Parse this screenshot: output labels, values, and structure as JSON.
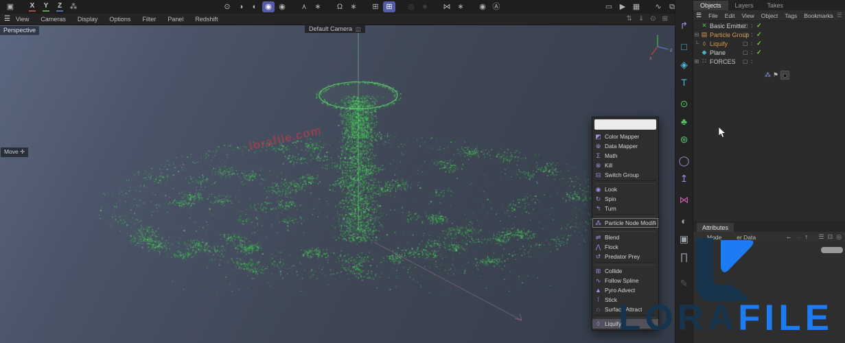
{
  "top_toolbar": {
    "icons": [
      {
        "icon": "window-tool-icon",
        "glyph": "▣",
        "cls": ""
      },
      {
        "icon": "axis-x-toggle",
        "glyph": "X",
        "cls": "gapM ax ux"
      },
      {
        "icon": "axis-y-toggle",
        "glyph": "Y",
        "cls": "ax uy"
      },
      {
        "icon": "axis-z-toggle",
        "glyph": "Z",
        "cls": "ax uz"
      },
      {
        "icon": "coordinate-system-icon",
        "glyph": "⁂",
        "cls": ""
      },
      {
        "icon": "snap-point-icon",
        "glyph": "⊙",
        "cls": "gapXL"
      },
      {
        "icon": "snap-edge-icon",
        "glyph": "◑",
        "cls": ""
      },
      {
        "icon": "snap-polygon-icon",
        "glyph": "◐",
        "cls": ""
      },
      {
        "icon": "modeling-mode-icon",
        "glyph": "◉",
        "cls": "sel"
      },
      {
        "icon": "modeling-alt-icon",
        "glyph": "◉",
        "cls": ""
      },
      {
        "icon": "character-tool-icon",
        "glyph": "⋏",
        "cls": "gapM"
      },
      {
        "icon": "gear-icon",
        "glyph": "∗",
        "cls": ""
      },
      {
        "icon": "magnet-tool-icon",
        "glyph": "Ω",
        "cls": "gapM"
      },
      {
        "icon": "gear-icon",
        "glyph": "∗",
        "cls": ""
      },
      {
        "icon": "grid-icon",
        "glyph": "⊞",
        "cls": "gapM"
      },
      {
        "icon": "quantize-grid-icon",
        "glyph": "⊞",
        "cls": "sel"
      },
      {
        "icon": "falloff-icon",
        "glyph": "◎",
        "cls": "gapM dis"
      },
      {
        "icon": "gear-icon",
        "glyph": "∗",
        "cls": "dis"
      },
      {
        "icon": "symmetry-tool-icon",
        "glyph": "⋈",
        "cls": "gapM"
      },
      {
        "icon": "gear-icon",
        "glyph": "∗",
        "cls": ""
      },
      {
        "icon": "capsule-tool-icon",
        "glyph": "◉",
        "cls": "gapM"
      },
      {
        "icon": "auto-mode-icon",
        "glyph": "Ⓐ",
        "cls": ""
      },
      {
        "icon": "render-view-icon",
        "glyph": "▭",
        "cls": "gapHuge"
      },
      {
        "icon": "render-play-icon",
        "glyph": "▶",
        "cls": ""
      },
      {
        "icon": "render-settings-icon",
        "glyph": "▦",
        "cls": ""
      },
      {
        "icon": "curve-editor-icon",
        "glyph": "∿",
        "cls": "gapM"
      },
      {
        "icon": "external-editor-icon",
        "glyph": "⧉",
        "cls": ""
      },
      {
        "icon": "capture-icon",
        "glyph": "◎",
        "cls": "gapM"
      }
    ]
  },
  "viewport_menubar": {
    "menu_icon": "☰",
    "items": [
      "View",
      "Cameras",
      "Display",
      "Options",
      "Filter",
      "Panel",
      "Redshift"
    ],
    "right_icons": [
      {
        "name": "swap-view-icon",
        "glyph": "⇅"
      },
      {
        "name": "push-view-icon",
        "glyph": "⇓"
      },
      {
        "name": "sync-view-icon",
        "glyph": "⊙"
      },
      {
        "name": "toggle-views-icon",
        "glyph": "⊞"
      }
    ]
  },
  "viewport": {
    "view_label": "Perspective",
    "camera_label": "Default Camera",
    "camera_icon_glyph": "◫",
    "tool_label": "Move",
    "tool_icon_glyph": "✛",
    "watermark_text": "lorafile.com",
    "axis_labels": {
      "x": "x",
      "z": "z"
    },
    "particles": {
      "colors": [
        "#2f9e43",
        "#45c155",
        "#58d068",
        "#6fe07a",
        "#1f7a33"
      ],
      "line_color": "#6fd47c",
      "spline_color": "rgba(220,140,170,0.5)"
    }
  },
  "context_menu": {
    "search_value": "",
    "items": [
      {
        "name": "menu-item-color-mapper",
        "label": "Color Mapper",
        "icon": "color-mapper-icon",
        "glyph": "◩",
        "cls": ""
      },
      {
        "name": "menu-item-data-mapper",
        "label": "Data Mapper",
        "icon": "data-mapper-icon",
        "glyph": "⊕",
        "cls": ""
      },
      {
        "name": "menu-item-math",
        "label": "Math",
        "icon": "math-icon",
        "glyph": "Σ",
        "cls": ""
      },
      {
        "name": "menu-item-kill",
        "label": "Kill",
        "icon": "kill-icon",
        "glyph": "⊗",
        "cls": ""
      },
      {
        "name": "menu-item-switch-group",
        "label": "Switch Group",
        "icon": "switch-group-icon",
        "glyph": "⊟",
        "cls": ""
      },
      {
        "name": "menu-separator",
        "label": "",
        "icon": "separator",
        "glyph": "",
        "cls": "sep"
      },
      {
        "name": "menu-item-look",
        "label": "Look",
        "icon": "look-icon",
        "glyph": "◉",
        "cls": ""
      },
      {
        "name": "menu-item-spin",
        "label": "Spin",
        "icon": "spin-icon",
        "glyph": "↻",
        "cls": ""
      },
      {
        "name": "menu-item-turn",
        "label": "Turn",
        "icon": "turn-icon",
        "glyph": "↰",
        "cls": ""
      },
      {
        "name": "menu-separator",
        "label": "",
        "icon": "separator",
        "glyph": "",
        "cls": "sep"
      },
      {
        "name": "menu-item-particle-node-modifier",
        "label": "Particle Node Modifier",
        "icon": "particle-node-modifier-icon",
        "glyph": "⁂",
        "cls": "boxed"
      },
      {
        "name": "menu-separator",
        "label": "",
        "icon": "separator",
        "glyph": "",
        "cls": "sep"
      },
      {
        "name": "menu-item-blend",
        "label": "Blend",
        "icon": "blend-icon",
        "glyph": "⇌",
        "cls": ""
      },
      {
        "name": "menu-item-flock",
        "label": "Flock",
        "icon": "flock-icon",
        "glyph": "⋀",
        "cls": ""
      },
      {
        "name": "menu-item-predator-prey",
        "label": "Predator Prey",
        "icon": "predator-prey-icon",
        "glyph": "↺",
        "cls": ""
      },
      {
        "name": "menu-separator",
        "label": "",
        "icon": "separator",
        "glyph": "",
        "cls": "sep"
      },
      {
        "name": "menu-item-collide",
        "label": "Collide",
        "icon": "collide-icon",
        "glyph": "⊞",
        "cls": ""
      },
      {
        "name": "menu-item-follow-spline",
        "label": "Follow Spline",
        "icon": "follow-spline-icon",
        "glyph": "∿",
        "cls": ""
      },
      {
        "name": "menu-item-pyro-advect",
        "label": "Pyro Advect",
        "icon": "pyro-advect-icon",
        "glyph": "▲",
        "cls": ""
      },
      {
        "name": "menu-item-stick",
        "label": "Stick",
        "icon": "stick-icon",
        "glyph": "⊺",
        "cls": ""
      },
      {
        "name": "menu-item-surface-attract",
        "label": "Surface Attract",
        "icon": "surface-attract-icon",
        "glyph": "∩",
        "cls": ""
      },
      {
        "name": "menu-separator",
        "label": "",
        "icon": "separator",
        "glyph": "",
        "cls": "sep"
      },
      {
        "name": "menu-item-liquify",
        "label": "Liquify",
        "icon": "liquify-icon",
        "glyph": "◊",
        "cls": "selected"
      }
    ]
  },
  "side_toolbar": {
    "icons": [
      {
        "icon": "spline-pen-icon",
        "glyph": "↱",
        "cls": "purple"
      },
      {
        "icon": "rectangle-spline-icon",
        "glyph": "□",
        "cls": "cyan gapS"
      },
      {
        "icon": "cube-primitive-icon",
        "glyph": "◈",
        "cls": "cyan"
      },
      {
        "icon": "text-object-icon",
        "glyph": "T",
        "cls": "cyan"
      },
      {
        "icon": "emitter-object-icon",
        "glyph": "⊙",
        "cls": "green gapS"
      },
      {
        "icon": "metaball-object-icon",
        "glyph": "♣",
        "cls": "green"
      },
      {
        "icon": "generator-object-icon",
        "glyph": "⊛",
        "cls": "green"
      },
      {
        "icon": "deformer-object-icon",
        "glyph": "◯",
        "cls": "purple gapS"
      },
      {
        "icon": "axis-modifier-icon",
        "glyph": "↥",
        "cls": "purple"
      },
      {
        "icon": "mograph-object-icon",
        "glyph": "⋈",
        "cls": "pink gapS"
      },
      {
        "icon": "sky-object-icon",
        "glyph": "◐",
        "cls": "slate gapS"
      },
      {
        "icon": "camera-object-icon",
        "glyph": "▣",
        "cls": "slate"
      },
      {
        "icon": "stage-object-icon",
        "glyph": "∏",
        "cls": "slate"
      },
      {
        "icon": "material-pen-icon",
        "glyph": "✎",
        "cls": "dim gapL"
      }
    ]
  },
  "right_panel": {
    "tabs": [
      {
        "label": "Objects",
        "cls": "active"
      },
      {
        "label": "Layers",
        "cls": ""
      },
      {
        "label": "Takes",
        "cls": ""
      }
    ],
    "menu_icon": "☰",
    "menu_items": [
      "File",
      "Edit",
      "View",
      "Object",
      "Tags",
      "Bookmarks"
    ],
    "menu_icons": [
      {
        "name": "search-icon",
        "glyph": "◌"
      },
      {
        "name": "home-icon",
        "glyph": "⌂"
      },
      {
        "name": "filter-icon",
        "glyph": "☰"
      }
    ],
    "tree": [
      {
        "name": "tree-row-basic-emitter",
        "expand": "",
        "glyph": "✕",
        "icon": "emitter-icon",
        "label": "Basic Emitter",
        "cls": "greenic",
        "lcls": "whitelab",
        "sq": "▢",
        "dots": ":",
        "check": "✓"
      },
      {
        "name": "tree-row-particle-group",
        "expand": "⊟",
        "glyph": "▤",
        "icon": "folder-icon",
        "label": "Particle Group",
        "cls": "orange",
        "lcls": "orange",
        "sq": "▢",
        "dots": ":",
        "check": "✓"
      },
      {
        "name": "tree-row-liquify",
        "expand": "└",
        "glyph": "◊",
        "icon": "droplet-icon",
        "label": "Liquify",
        "cls": "orange",
        "lcls": "orange",
        "sq": "▢",
        "dots": ":",
        "check": "✓"
      },
      {
        "name": "tree-row-plane",
        "expand": "",
        "glyph": "◆",
        "icon": "plane-icon",
        "label": "Plane",
        "cls": "cyanic",
        "lcls": "whitelab",
        "sq": "▢",
        "dots": ":",
        "check": "✓"
      },
      {
        "name": "tree-row-forces",
        "expand": "⊞",
        "glyph": "∷",
        "icon": "forces-icon",
        "label": "FORCES",
        "cls": "graylab",
        "lcls": "graylab",
        "sq": "▢",
        "dots": ":",
        "check": ""
      }
    ],
    "tree_tags": [
      {
        "name": "xpresso-tag-icon",
        "glyph": "⁂",
        "cls": "blue"
      },
      {
        "name": "flag-tag-icon",
        "glyph": "⚑",
        "cls": "flag"
      },
      {
        "name": "material-tag-icon",
        "glyph": "●",
        "cls": "mat"
      }
    ]
  },
  "attributes_panel": {
    "tab_label": "Attributes",
    "mode_label": "Mode",
    "field_label": "er Data",
    "icons": [
      {
        "name": "back-arrow-icon",
        "glyph": "←",
        "cls": "lit"
      },
      {
        "name": "forward-arrow-icon",
        "glyph": "→",
        "cls": "dimi"
      },
      {
        "name": "up-arrow-icon",
        "glyph": "↑",
        "cls": "lit"
      },
      {
        "name": "search-icon",
        "glyph": "◌",
        "cls": "dimi"
      },
      {
        "name": "filter-icon",
        "glyph": "☰",
        "cls": "mid"
      },
      {
        "name": "lock-icon",
        "glyph": "⊡",
        "cls": "mid"
      },
      {
        "name": "history-icon",
        "glyph": "◎",
        "cls": "mid"
      }
    ]
  },
  "brand": {
    "word_left": "LORA",
    "word_right": "FILE",
    "color_left": "#17344f",
    "color_right": "#1d7bf4"
  }
}
